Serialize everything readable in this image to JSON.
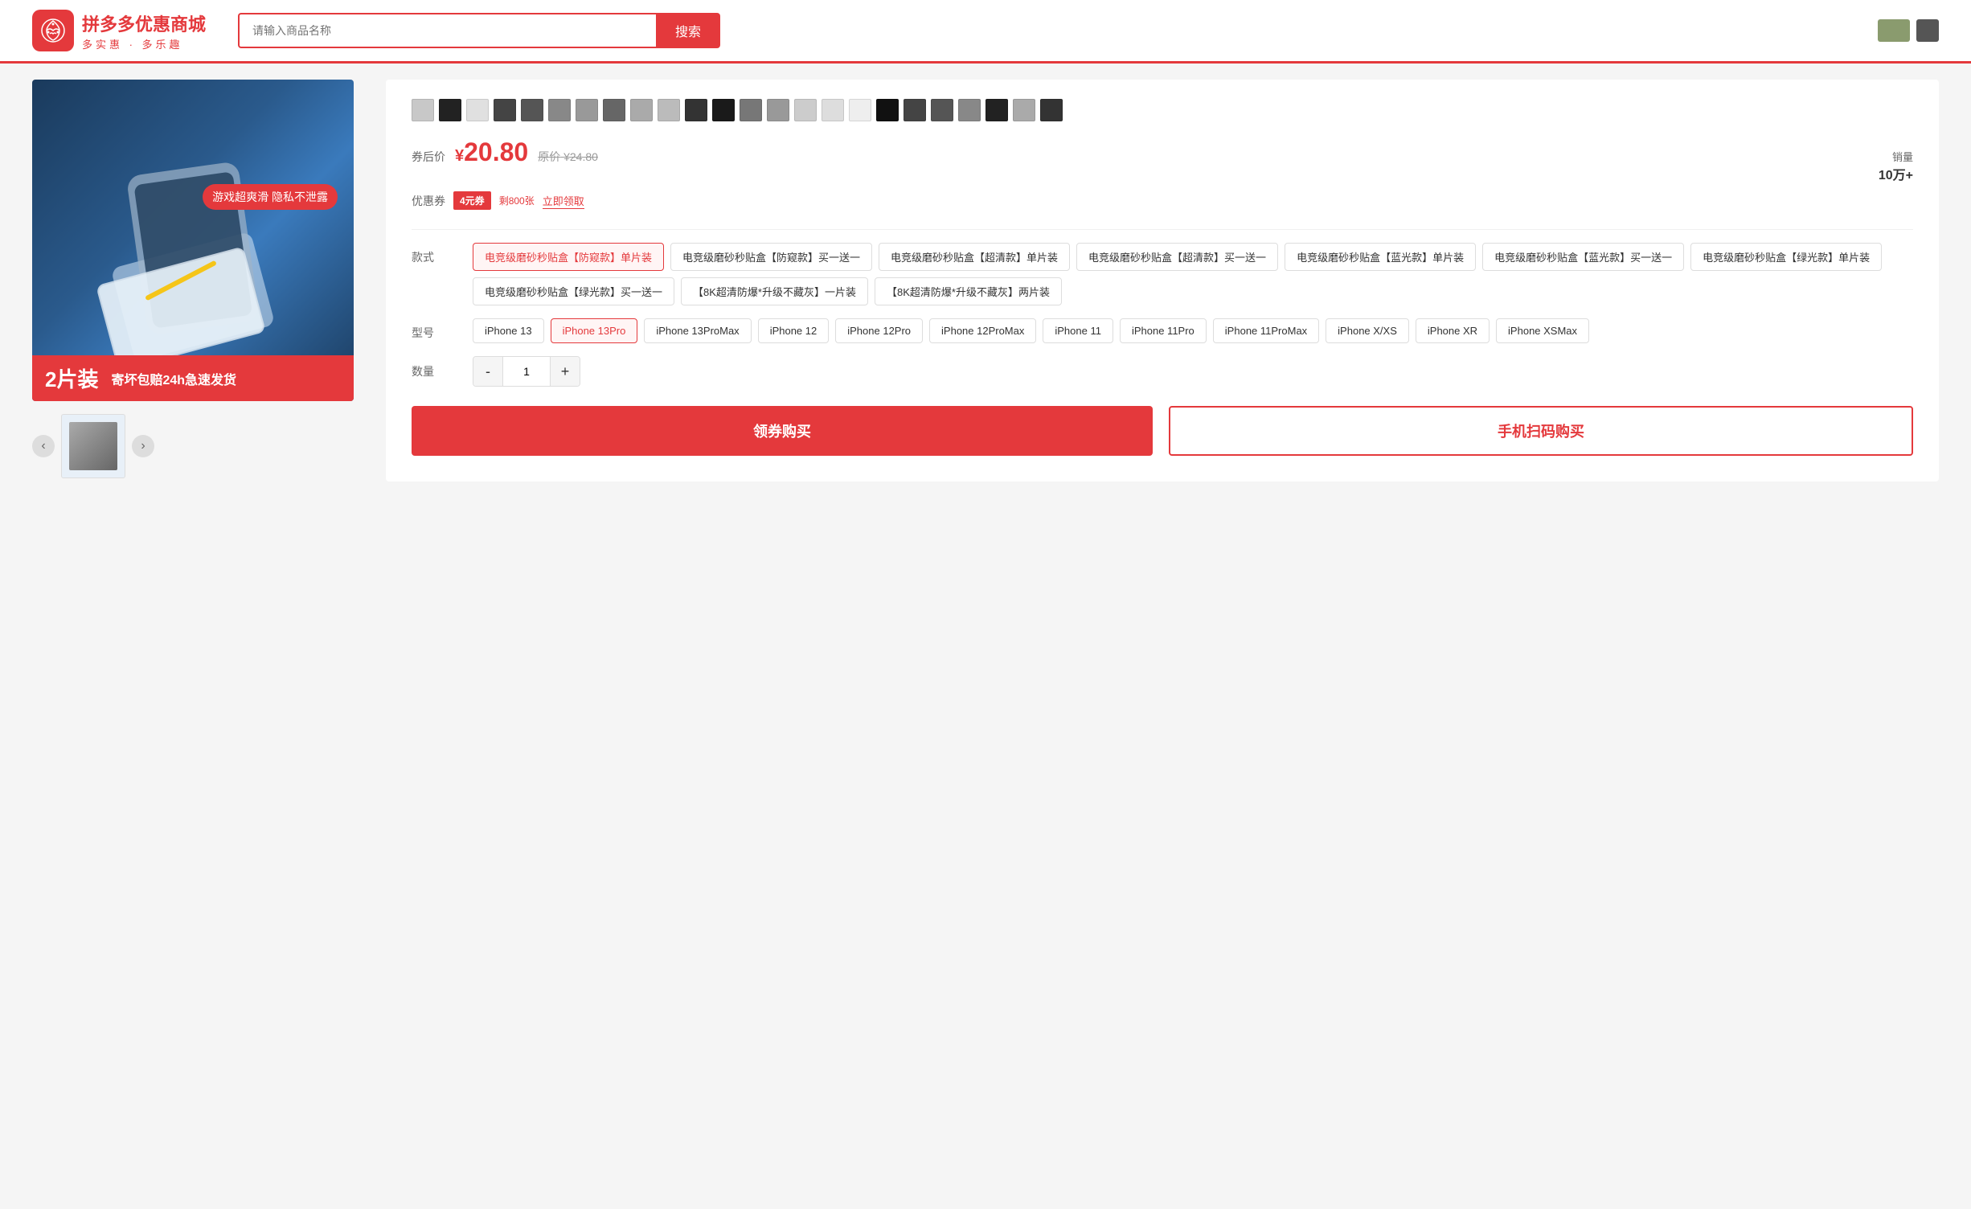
{
  "header": {
    "logo_title": "拼多多优惠商城",
    "logo_subtitle": "多实惠 · 多乐趣",
    "search_placeholder": "请输入商品名称",
    "search_button": "搜索"
  },
  "product": {
    "badge_2pcs": "2片装",
    "badge_shipping": "寄坏包赔24h急速发货",
    "game_badge": "游戏超爽滑 隐私不泄露",
    "price_label": "券后价",
    "price_yuan_symbol": "¥",
    "price_current": "20.80",
    "price_original_label": "原价",
    "price_original": "¥24.80",
    "sales_label": "销量",
    "sales_count": "10万+",
    "coupon_label": "优惠券",
    "coupon_tag": "4元券",
    "coupon_remain": "剩800张",
    "coupon_claim": "立即领取",
    "style_label": "款式",
    "model_label": "型号",
    "qty_label": "数量",
    "qty_value": "1",
    "qty_minus": "-",
    "qty_plus": "+",
    "btn_coupon_buy": "领券购买",
    "btn_scan_buy": "手机扫码购买",
    "styles": [
      {
        "label": "电竞级磨砂秒贴盒【防窥款】单片装",
        "selected": true
      },
      {
        "label": "电竞级磨砂秒贴盒【防窥款】买一送一",
        "selected": false
      },
      {
        "label": "电竞级磨砂秒贴盒【超清款】单片装",
        "selected": false
      },
      {
        "label": "电竞级磨砂秒贴盒【超清款】买一送一",
        "selected": false
      },
      {
        "label": "电竞级磨砂秒贴盒【蓝光款】单片装",
        "selected": false
      },
      {
        "label": "电竞级磨砂秒贴盒【蓝光款】买一送一",
        "selected": false
      },
      {
        "label": "电竞级磨砂秒贴盒【绿光款】单片装",
        "selected": false
      },
      {
        "label": "电竞级磨砂秒贴盒【绿光款】买一送一",
        "selected": false
      },
      {
        "label": "【8K超清防爆*升级不藏灰】一片装",
        "selected": false
      },
      {
        "label": "【8K超清防爆*升级不藏灰】两片装",
        "selected": false
      }
    ],
    "models": [
      {
        "label": "iPhone 13",
        "selected": false
      },
      {
        "label": "iPhone 13Pro",
        "selected": true
      },
      {
        "label": "iPhone 13ProMax",
        "selected": false
      },
      {
        "label": "iPhone 12",
        "selected": false
      },
      {
        "label": "iPhone 12Pro",
        "selected": false
      },
      {
        "label": "iPhone 12ProMax",
        "selected": false
      },
      {
        "label": "iPhone 11",
        "selected": false
      },
      {
        "label": "iPhone 11Pro",
        "selected": false
      },
      {
        "label": "iPhone 11ProMax",
        "selected": false
      },
      {
        "label": "iPhone X/XS",
        "selected": false
      },
      {
        "label": "iPhone XR",
        "selected": false
      },
      {
        "label": "iPhone XSMax",
        "selected": false
      }
    ],
    "swatches": [
      {
        "color": "#c8c8c8"
      },
      {
        "color": "#222222"
      },
      {
        "color": "#e0e0e0"
      },
      {
        "color": "#444444"
      },
      {
        "color": "#555555"
      },
      {
        "color": "#888888"
      },
      {
        "color": "#999999"
      },
      {
        "color": "#666666"
      },
      {
        "color": "#aaaaaa"
      },
      {
        "color": "#bbbbbb"
      },
      {
        "color": "#333333"
      },
      {
        "color": "#1a1a1a"
      },
      {
        "color": "#777777"
      },
      {
        "color": "#999999"
      },
      {
        "color": "#cccccc"
      },
      {
        "color": "#dddddd"
      },
      {
        "color": "#eeeeee"
      },
      {
        "color": "#111111"
      },
      {
        "color": "#444444"
      },
      {
        "color": "#555555"
      },
      {
        "color": "#888888"
      },
      {
        "color": "#222222"
      },
      {
        "color": "#aaaaaa"
      },
      {
        "color": "#333333"
      }
    ]
  }
}
